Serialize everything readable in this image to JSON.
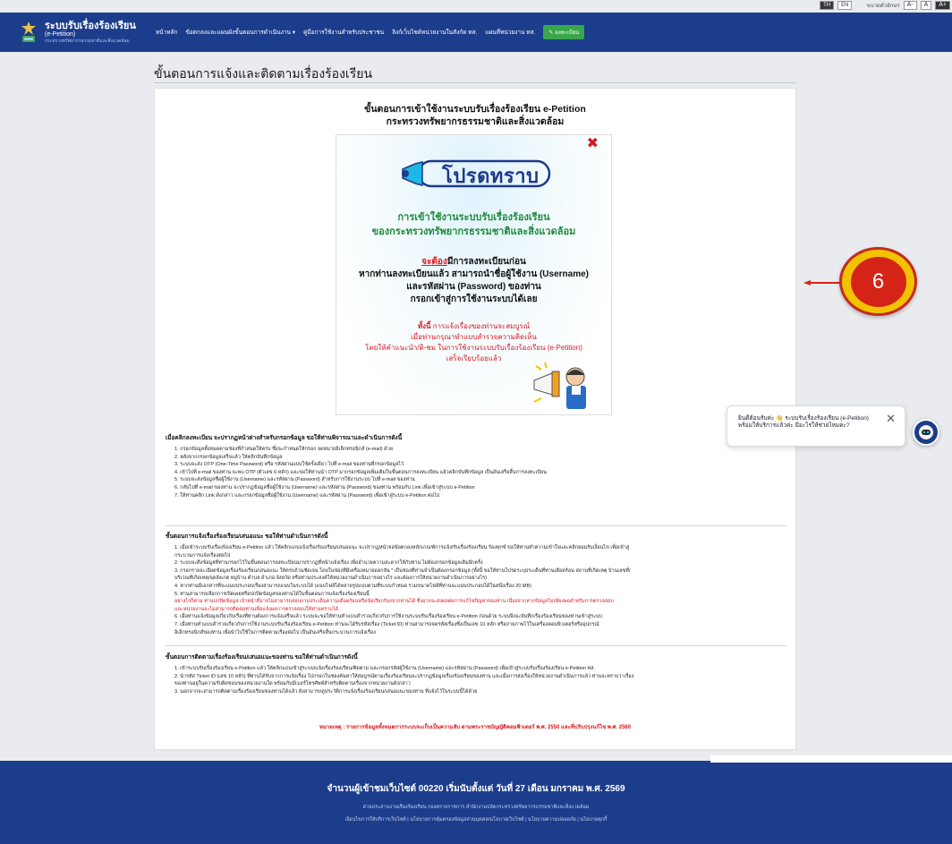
{
  "utility_bar": {
    "languages": [
      "TH",
      "EN"
    ],
    "font_size_label": "ขนาดตัวอักษร",
    "font_sizes": [
      "A-",
      "A",
      "A+"
    ]
  },
  "header": {
    "logo": {
      "title": "ระบบรับเรื่องร้องเรียน",
      "subtitle": "(e-Petition)",
      "org": "กระทรวงทรัพยากรธรรมชาติและสิ่งแวดล้อม"
    },
    "menu": [
      {
        "label": "หน้าหลัก"
      },
      {
        "label": "ข้อตกลงและแผนผังขั้นตอนการดำเนินงาน ▾"
      },
      {
        "label": "คู่มือการใช้งานสำหรับประชาชน"
      },
      {
        "label": "ลิงก์เว็บไซต์หน่วยงานในสังกัด ทส."
      },
      {
        "label": "แผนที่หน่วยงาน ทส."
      }
    ],
    "register_label": "ลงทะเบียน"
  },
  "page": {
    "title": "ขั้นตอนการแจ้งและติดตามเรื่องร้องเรียน"
  },
  "card": {
    "heading_line1": "ขั้นตอนการเข้าใช้งานระบบรับเรื่องร้องเรียน e-Petition",
    "heading_line2": "กระทรวงทรัพยากรธรรมชาติและสิ่งแวดล้อม"
  },
  "poster": {
    "banner": "โปรดทราบ",
    "green_line1": "การเข้าใช้งานระบบรับเรื่องร้องเรียน",
    "green_line2": "ของกระทรวงทรัพยากรธรรมชาติและสิ่งแวดล้อม",
    "must": "จะต้อง",
    "black_line1_rest": "มีการลงทะเบียนก่อน",
    "black_line2": "หากท่านลงทะเบียนแล้ว สามารถนำชื่อผู้ใช้งาน (Username)",
    "black_line3": "และรหัสผ่าน (Password) ของท่าน",
    "black_line4": "กรอกเข้าสู่การใช้งานระบบได้เลย",
    "red_bold": "ทั้งนี้",
    "red_line1_rest": " การแจ้งเรื่องของท่านจะสมบูรณ์",
    "red_line2": "เมื่อท่านกรุณาทำแบบสำรวจความคิดเห็น",
    "red_line3": "โดยให้คำแนะนำ/ติ-ชม ในการใช้งานระบบรับเรื่องร้องเรียน (e-Petition)",
    "red_line4": "เสร็จเรียบร้อยแล้ว"
  },
  "annotation": {
    "number": "6"
  },
  "chat": {
    "message": "ยินดีต้อนรับค่ะ 👋 ระบบรับเรื่องร้องเรียน (e-Petition) พร้อมให้บริการแล้วค่ะ มีอะไรให้ช่วยไหมคะ?"
  },
  "sections": [
    {
      "title": "เมื่อคลิกลงทะเบียน จะปรากฏหน้าต่างสำหรับกรอกข้อมูล ขอให้ท่านพิจารณาและดำเนินการดังนี้",
      "items": [
        "1. กรอกข้อมูลทั้งหมดตามช่องที่กำหนดให้ครบ ซึ่งจะกำหนดให้กรอก จดหมายอิเล็กทรอนิกส์ (e-mail) ด้วย",
        "2. หลังจากกรอกข้อมูลเสร็จแล้ว ให้คลิกบันทึกข้อมูล",
        "3. ระบบจะส่ง OTP (One-Time Password) หรือ รหัสผ่านแบบใช้ครั้งเดียว ไปที่ e-mail ของท่านที่กรอกข้อมูลไว้",
        "4. เข้าไปที่ e-mail ของท่าน จะพบ OTP (ตัวเลข 6 หลัก) และขอให้ท่านนำ OTP มากรอกข้อมูลเพิ่มเติมในขั้นตอนการลงทะเบียน แล้วคลิกบันทึกข้อมูล เป็นอันเสร็จสิ้นการลงทะเบียน",
        "5. ระบบจะส่งข้อมูลชื่อผู้ใช้งาน (Username) และรหัสผ่าน (Password) สำหรับการใช้งานระบบ ไปที่ e-mail ของท่าน",
        "6. กลับไปที่ e-mail ของท่าน จะปรากฏข้อมูลชื่อผู้ใช้งาน (Username) และรหัสผ่าน (Password) ของท่าน พร้อมกับ Link เพื่อเข้าสู่ระบบ e-Petition",
        "7. ให้ท่านคลิก Link ดังกล่าว และกรอกข้อมูลชื่อผู้ใช้งาน (Username) และรหัสผ่าน (Password) เพื่อเข้าสู่ระบบ e-Petition ต่อไป"
      ]
    },
    {
      "title": "ขั้นตอนการแจ้งเรื่องร้องเรียน/เสนอแนะ ขอให้ท่านดำเนินการดังนี้",
      "items": [
        "1. เมื่อเข้าระบบรับเรื่องร้องเรียน e-Petition แล้ว ให้คลิกแถบแจ้งเรื่องร้องเรียน/เสนอแนะ จะปรากฏหน้าจอข้อตกลงหลักเกณฑ์การแจ้ง/รับเรื่องร้องเรียน ร้องทุกข์ ขอให้ท่านทำความเข้าใจและคลิกยอมรับเงื่อนไข เพื่อเข้าสู่",
        "กระบวนการแจ้งเรื่องต่อไป",
        "2. ระบบจะดึงข้อมูลที่ท่านกรอกไว้ในขั้นตอนการลงทะเบียนมาปรากฏที่หน้าแจ้งเรื่อง เพื่ออำนวยความสะดวกให้กับท่าน ไม่ต้องกรอกข้อมูลเดิมอีกครั้ง",
        "3. กรอกรายละเอียดข้อมูลเรื่องร้องเรียน/เสนอแนะ ให้ครบถ้วนชัดเจน โดยในช่องที่มีเครื่องหมายดอกจัน * เป็นช่องที่ท่านจำเป็นต้องกรอกข้อมูล (ทั้งนี้ ขอให้ท่านโปรดระบุประเด็นที่ท่านเดือดร้อน สถานที่เกิดเหตุ บ้านเลขที่/",
        "บริเวณที่เกิดเหตุ/จุดสังเกต หมู่บ้าน ตำบล อำเภอ จังหวัด หรือท่านประสงค์ให้หน่วยงานดำเนินการอย่างไร และต้องการให้หน่วยงานดำเนินการอย่างไร)",
        "4. หากท่านมีเอกสารที่จะแนบประกอบเรื่องสามารถแนบในระบบได้ (แนบไฟล์ได้หลายรูปแบบตามที่ระบบกำหนด รวมขนาดไฟล์ที่ท่านจะแนบประกอบได้ในหนึ่งเรื่อง 20 MB)",
        "5. ท่านสามารถเลือกการเปิดเผยหรือปกปิดข้อมูลของท่านได้ในขั้นตอนการแจ้งเรื่องร้องเรียนนี้"
      ],
      "red_items": [
        "อย่างไรก็ตาม ท่านปกปิดข้อมูล เจ้าหน้าที่อาจไม่สามารถสอบถามประเด็นความเดือดร้อนหรือข้อเรียกร้องจากท่านได้ ซึ่งอาจจะส่งผลต่อการแก้ไขปัญหาของท่าน เนื่องจากหากข้อมูลไม่เพียงพอสำหรับการตรวจสอบ",
        "และหน่วยงานจะไม่สามารถติดต่อท่านเพื่อแจ้งผลการตรวจสอบให้ท่านทราบได้"
      ],
      "items_after": [
        "6. เมื่อท่านแจ้งข้อมูลเกี่ยวกับเรื่องที่ท่านต้องการแจ้งเสร็จแล้ว ระบบจะขอให้ท่านทำแบบสำรวจเกี่ยวกับการใช้งานระบบรับเรื่องร้องเรียน e-Petition ก่อนด้วย ระบบจึงจะบันทึกเรื่องร้องเรียนของท่านเข้าสู่ระบบ",
        "7. เมื่อท่านทำแบบสำรวจเกี่ยวกับการใช้งานระบบรับเรื่องร้องเรียน e-Petition ท่านจะได้รับรหัสเรื่อง (Ticket ID) ท่านสามารถจดรหัสเรื่องซึ่งเป็นเลข 10 หลัก หรือถ่ายภาพไว้ในเครื่องคอมพิวเตอร์หรืออุปกรณ์",
        "อิเล็กทรอนิกส์ของท่าน เพื่อนำไปใช้ในการติดตามเรื่องต่อไป เป็นอันเสร็จสิ้นกระบวนการแจ้งเรื่อง"
      ]
    },
    {
      "title": "ขั้นตอนการติดตามเรื่องร้องเรียน/เสนอแนะของท่าน ขอให้ท่านดำเนินการดังนี้",
      "items": [
        "1. เข้าระบบรับเรื่องร้องเรียน e-Petition แล้ว ให้คลิกแถบเข้าสู่ระบบ/แจ้งเรื่องร้องเรียน/ติดตาม และกรอกรหัสผู้ใช้งาน (Username) และรหัสผ่าน (Password) เพื่อเข้าสู่ระบบรับเรื่องร้องเรียน e-Petition ทส.",
        "2. นำรหัส Ticket ID (เลข 10 หลัก) ที่ท่านได้รับจากการแจ้งเรื่อง ไปกรอกในช่องค้นหาให้สมบูรณ์ตามเรื่องร้องเรียนจะปรากฏข้อมูลเรื่องร้องเรียนของท่าน และเมื่อการส่งเรื่องให้หน่วยงานดำเนินการแล้ว ท่านจะทราบว่าเรื่อง",
        "ของท่านอยู่ในความรับผิดชอบของหน่วยงานใด พร้อมกับมีเบอร์โทรศัพท์สำหรับติดตามเรื่องจากหน่วยงานดังกล่าว",
        "3. นอกจากจะสามารถติดตามเรื่องร้องเรียนของท่านได้แล้ว ยังสามารถดูประวัติการแจ้งเรื่องร้องเรียน/เสนอแนะของท่าน ที่แจ้งไว้ในระบบนี้ได้ด้วย"
      ]
    }
  ],
  "note": "หมายเหตุ : รายการข้อมูลทั้งหมดการระบบจะเก็บเป็นความลับ ตามพระราชบัญญัติคอมพิวเตอร์ พ.ศ. 2550 และที่ปรับปรุงแก้ไข พ.ศ. 2560",
  "footer": {
    "counter": "จำนวนผู้เข้าชมเว็บไซต์ 00220 เริ่มนับตั้งแต่ วันที่ 27 เดือน มกราคม พ.ศ. 2569",
    "agency": "ส่วนประสานงานเรื่องร้องเรียน กองตรวจราชการ สำนักงานปลัดกระทรวงทรัพยากรธรรมชาติและสิ่งแวดล้อม",
    "links": "เงื่อนไขการให้บริการเว็บไซต์ | นโยบายการคุ้มครองข้อมูลส่วนบุคคล/นโยบายเว็บไซต์ | นโยบายความปลอดภัย | นโยบายคุกกี้"
  },
  "colors": {
    "brand_blue": "#1c3d8c",
    "register_green": "#3aa64a",
    "alert_red": "#d71920",
    "poster_green": "#1f8a3b",
    "callout_yellow": "#f2c200"
  },
  "icons": [
    "emblem-icon",
    "close-icon",
    "megaphone-icon",
    "arrow-left-icon",
    "chatbot-icon",
    "edit-icon"
  ]
}
